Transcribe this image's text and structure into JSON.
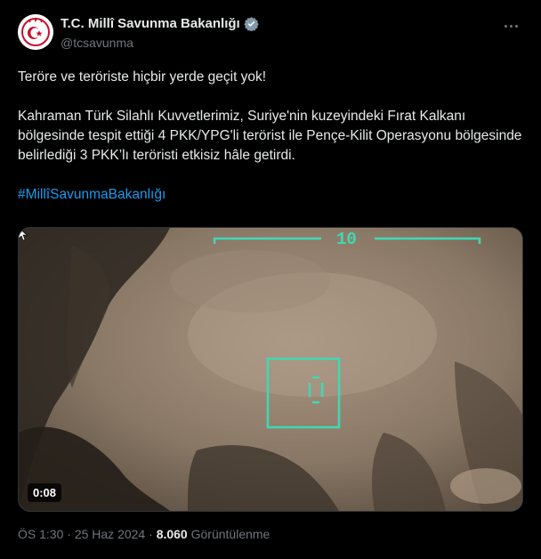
{
  "account": {
    "display_name": "T.C. Millî Savunma Bakanlığı",
    "handle": "@tcsavunma",
    "verified_icon": "verified-badge-icon",
    "more_icon": "more-options-icon"
  },
  "tweet": {
    "headline": "Teröre ve teröriste hiçbir yerde geçit yok!",
    "body": "Kahraman Türk Silahlı Kuvvetlerimiz, Suriye'nin kuzeyindeki Fırat Kalkanı bölgesinde tespit ettiği 4 PKK/YPG'li terörist ile Pençe-Kilit Operasyonu bölgesinde belirlediği 3 PKK’lı teröristi etkisiz hâle getirdi.",
    "hashtag": "#MillîSavunmaBakanlığı"
  },
  "media": {
    "type": "video",
    "hud_number": "10",
    "duration": "0:08"
  },
  "meta": {
    "time": "ÖS 1:30",
    "separator": "·",
    "date": "25 Haz 2024",
    "views_count": "8.060",
    "views_label": "Görüntülenme"
  },
  "colors": {
    "background": "#000000",
    "text": "#e7e9ea",
    "muted": "#71767b",
    "link": "#1d9bf0",
    "hud": "#3fd9b5",
    "avatar_red": "#c8102e"
  }
}
